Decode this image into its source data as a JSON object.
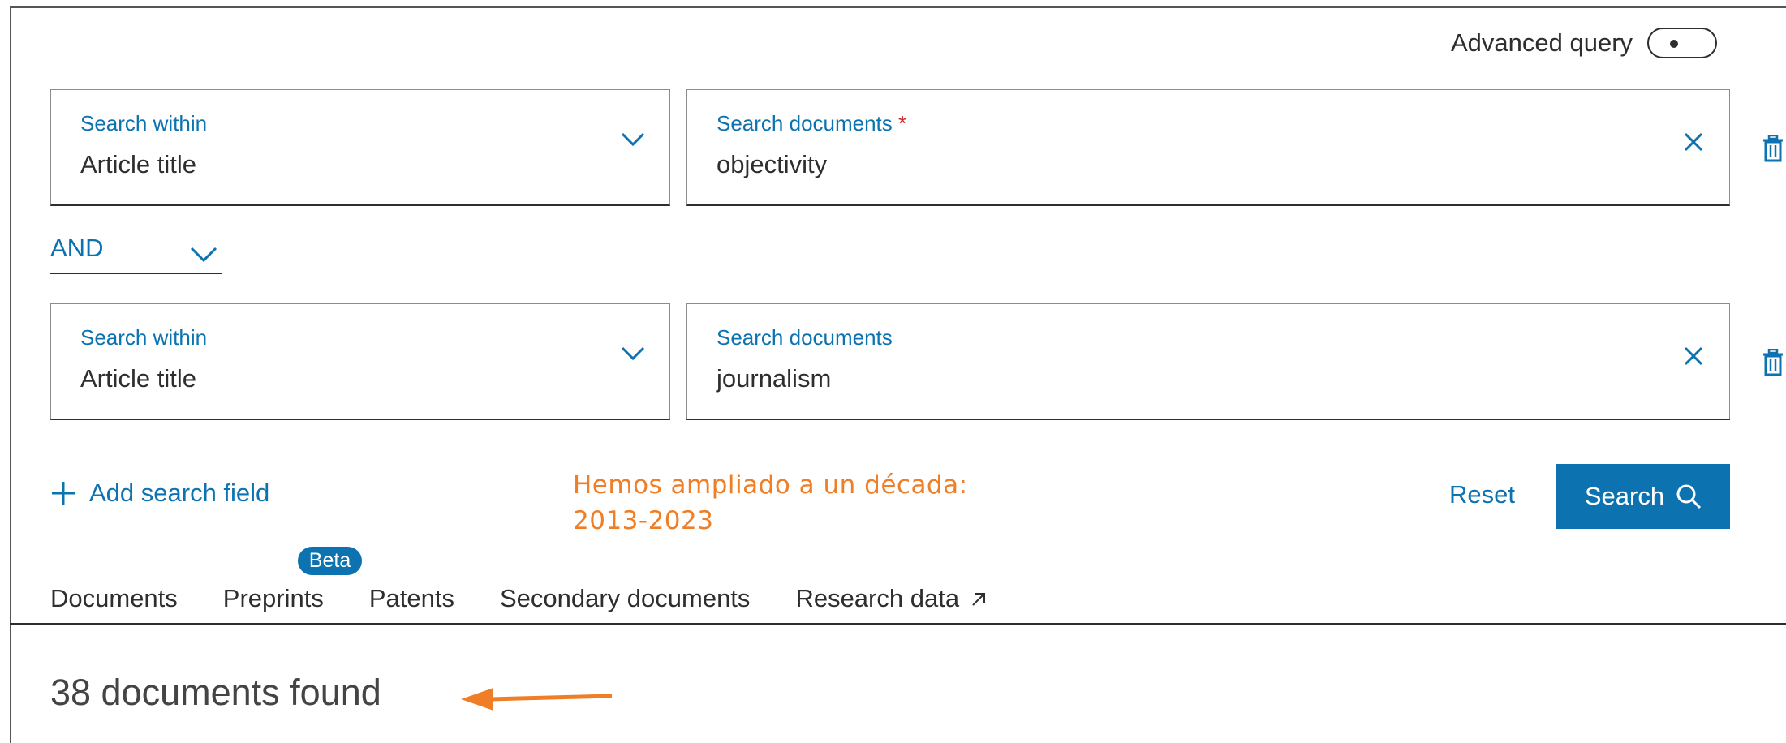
{
  "advanced_query": {
    "label": "Advanced query",
    "enabled": false
  },
  "rows": [
    {
      "within_label": "Search within",
      "within_value": "Article title",
      "docs_label": "Search documents",
      "docs_required": "*",
      "docs_value": "objectivity"
    },
    {
      "within_label": "Search within",
      "within_value": "Article title",
      "docs_label": "Search documents",
      "docs_value": "journalism"
    }
  ],
  "operator": "AND",
  "add_field_label": "Add search field",
  "annotation": {
    "line1": "Hemos ampliado a un década:",
    "line2": "2013-2023",
    "color": "#f07e26"
  },
  "reset_label": "Reset",
  "search_label": "Search",
  "tabs": [
    {
      "label": "Documents"
    },
    {
      "label": "Preprints",
      "badge": "Beta"
    },
    {
      "label": "Patents"
    },
    {
      "label": "Secondary documents"
    },
    {
      "label": "Research data"
    }
  ],
  "results_text": "38 documents found",
  "colors": {
    "accent": "#0c73b0",
    "required": "#c2272d",
    "annotation": "#f07e26"
  }
}
